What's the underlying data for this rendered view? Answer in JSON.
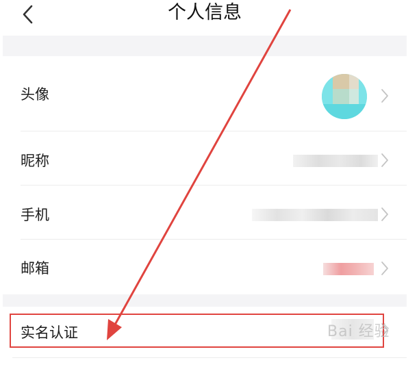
{
  "header": {
    "title": "个人信息",
    "back_icon": "chevron-left-icon"
  },
  "profile": {
    "avatar_label": "头像",
    "nickname_label": "昵称",
    "phone_label": "手机",
    "email_label": "邮箱"
  },
  "verification": {
    "realname_label": "实名认证"
  },
  "annotation": {
    "highlight_color": "#e0443f",
    "arrow_color": "#e0443f"
  },
  "watermark": {
    "text": "Bai 经验"
  }
}
